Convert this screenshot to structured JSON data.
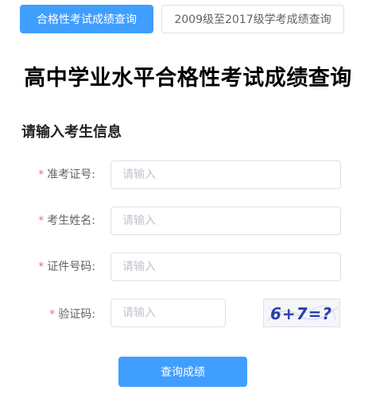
{
  "tabs": [
    {
      "label": "合格性考试成绩查询",
      "active": true
    },
    {
      "label": "2009级至2017级学考成绩查询",
      "active": false
    }
  ],
  "page_title": "高中学业水平合格性考试成绩查询",
  "section_title": "请输入考生信息",
  "required_mark": "*",
  "fields": {
    "admission_no": {
      "label": "准考证号:",
      "placeholder": "请输入",
      "value": ""
    },
    "name": {
      "label": "考生姓名:",
      "placeholder": "请输入",
      "value": ""
    },
    "id_no": {
      "label": "证件号码:",
      "placeholder": "请输入",
      "value": ""
    },
    "verify_code": {
      "label": "验证码:",
      "placeholder": "请输入",
      "value": ""
    }
  },
  "captcha": {
    "text": "6+7=?",
    "color": "#2b3fa8"
  },
  "submit_label": "查询成绩",
  "colors": {
    "primary": "#409eff",
    "required": "#f56c6c",
    "border": "#dcdfe6",
    "placeholder": "#c0c4cc"
  }
}
